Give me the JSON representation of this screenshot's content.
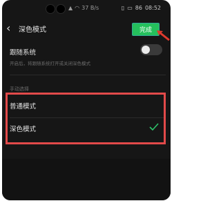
{
  "status_bar": {
    "signal_text": "37 B/s",
    "battery_text": "86",
    "time": "08:52"
  },
  "header": {
    "back_icon": "chevron-left-icon",
    "title": "深色模式",
    "done_label": "完成"
  },
  "follow_system": {
    "label": "跟随系统",
    "description": "开启后，将跟随系统打开或关闭深色模式",
    "enabled": false
  },
  "manual_section": {
    "label": "手动选择",
    "options": [
      {
        "label": "普通模式",
        "selected": false
      },
      {
        "label": "深色模式",
        "selected": true
      }
    ]
  },
  "colors": {
    "done_button": "#25c05c",
    "check": "#2ec46b",
    "highlight_box": "#e24a4a"
  }
}
